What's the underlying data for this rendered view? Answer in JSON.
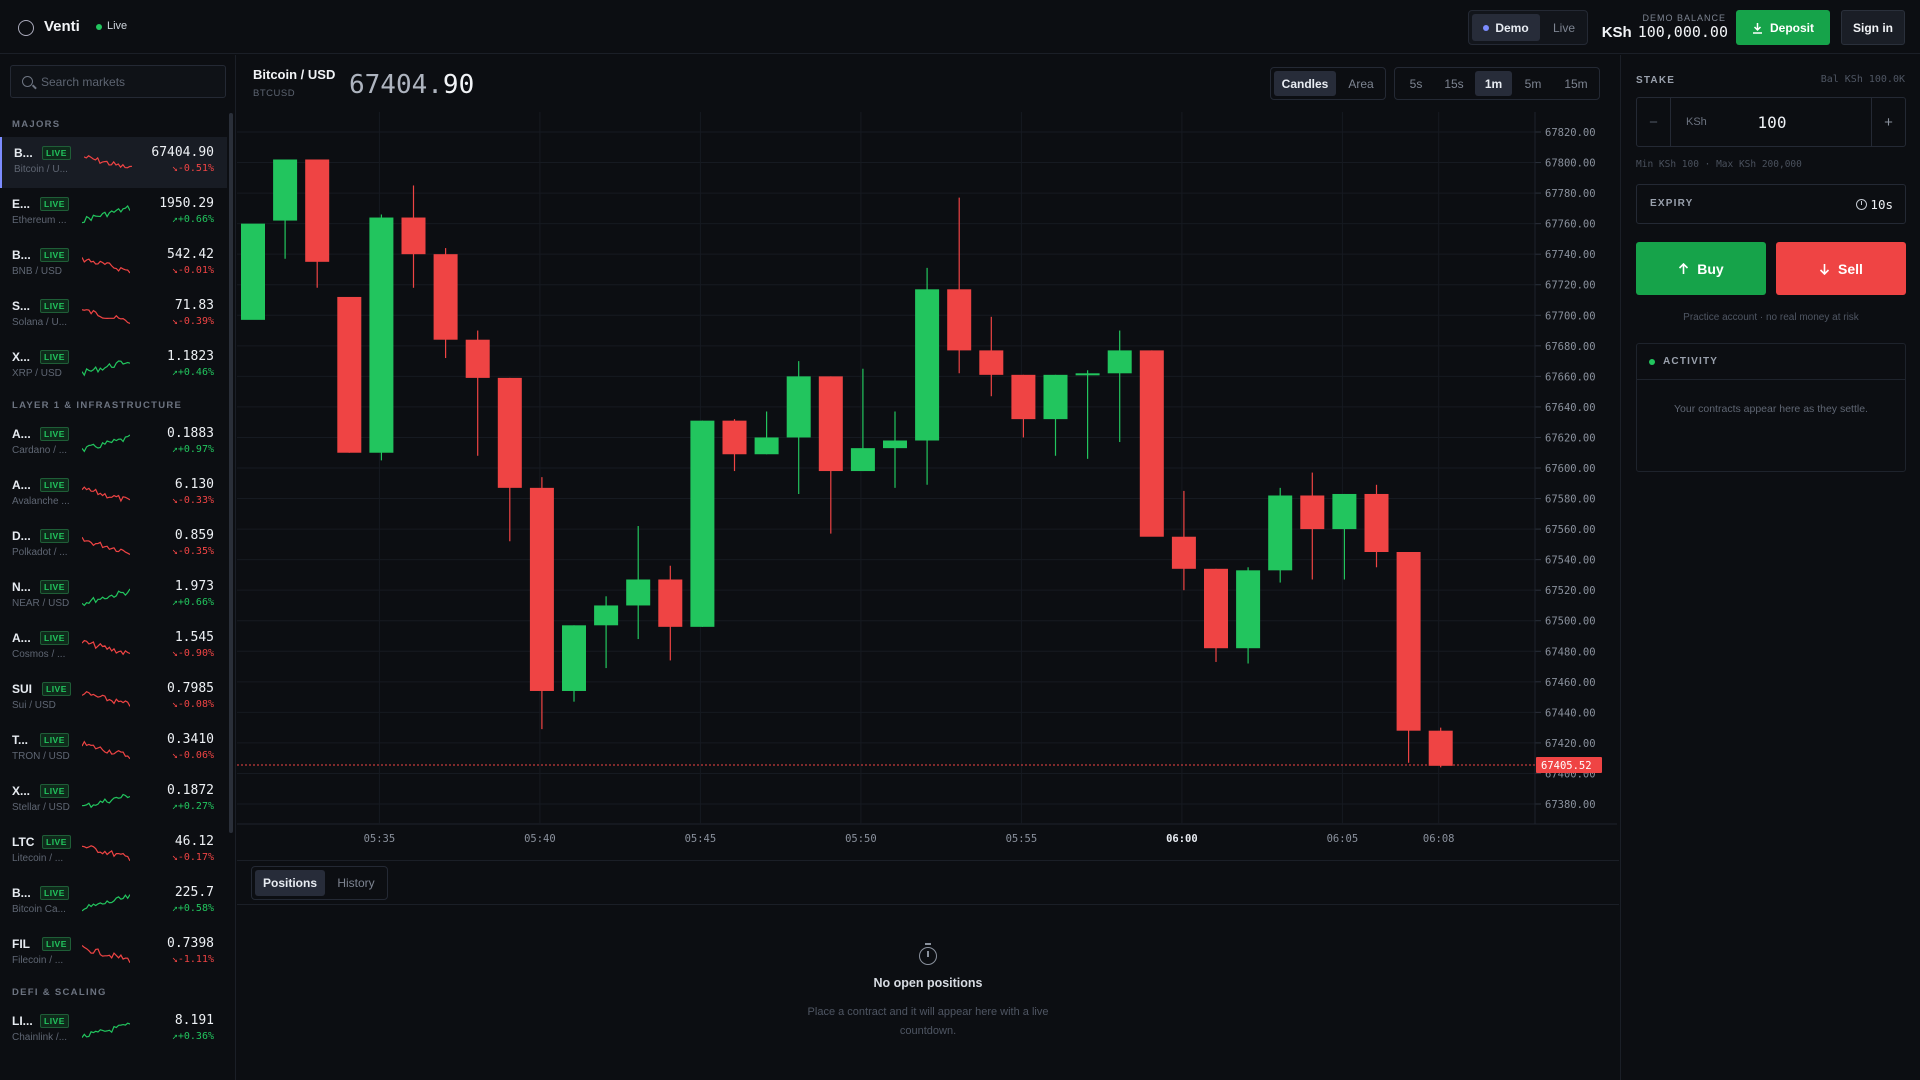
{
  "header": {
    "brand": "Venti",
    "status": "Live",
    "modes": [
      "Demo",
      "Live"
    ],
    "active_mode": "Demo",
    "balance_label": "DEMO BALANCE",
    "balance_currency": "KSh",
    "balance_value": "100,000.00",
    "deposit_label": "Deposit",
    "signin_label": "Sign in"
  },
  "sidebar": {
    "search_placeholder": "Search markets",
    "groups": [
      {
        "title": "MAJORS",
        "items": [
          {
            "sym": "B...",
            "name": "Bitcoin / U...",
            "price": "67404.90",
            "change": "-0.51%",
            "dir": "dn",
            "selected": true
          },
          {
            "sym": "E...",
            "name": "Ethereum ...",
            "price": "1950.29",
            "change": "+0.66%",
            "dir": "up"
          },
          {
            "sym": "B...",
            "name": "BNB / USD",
            "price": "542.42",
            "change": "-0.01%",
            "dir": "dn"
          },
          {
            "sym": "S...",
            "name": "Solana / U...",
            "price": "71.83",
            "change": "-0.39%",
            "dir": "dn"
          },
          {
            "sym": "X...",
            "name": "XRP / USD",
            "price": "1.1823",
            "change": "+0.46%",
            "dir": "up"
          }
        ]
      },
      {
        "title": "LAYER 1 & INFRASTRUCTURE",
        "items": [
          {
            "sym": "A...",
            "name": "Cardano / ...",
            "price": "0.1883",
            "change": "+0.97%",
            "dir": "up"
          },
          {
            "sym": "A...",
            "name": "Avalanche ...",
            "price": "6.130",
            "change": "-0.33%",
            "dir": "dn"
          },
          {
            "sym": "D...",
            "name": "Polkadot / ...",
            "price": "0.859",
            "change": "-0.35%",
            "dir": "dn"
          },
          {
            "sym": "N...",
            "name": "NEAR / USD",
            "price": "1.973",
            "change": "+0.66%",
            "dir": "up"
          },
          {
            "sym": "A...",
            "name": "Cosmos / ...",
            "price": "1.545",
            "change": "-0.90%",
            "dir": "dn"
          },
          {
            "sym": "SUI",
            "name": "Sui / USD",
            "price": "0.7985",
            "change": "-0.08%",
            "dir": "dn"
          },
          {
            "sym": "T...",
            "name": "TRON / USD",
            "price": "0.3410",
            "change": "-0.06%",
            "dir": "dn"
          },
          {
            "sym": "X...",
            "name": "Stellar / USD",
            "price": "0.1872",
            "change": "+0.27%",
            "dir": "up"
          },
          {
            "sym": "LTC",
            "name": "Litecoin / ...",
            "price": "46.12",
            "change": "-0.17%",
            "dir": "dn"
          },
          {
            "sym": "B...",
            "name": "Bitcoin Ca...",
            "price": "225.7",
            "change": "+0.58%",
            "dir": "up"
          },
          {
            "sym": "FIL",
            "name": "Filecoin / ...",
            "price": "0.7398",
            "change": "-1.11%",
            "dir": "dn"
          }
        ]
      },
      {
        "title": "DEFI & SCALING",
        "items": [
          {
            "sym": "LI...",
            "name": "Chainlink /...",
            "price": "8.191",
            "change": "+0.36%",
            "dir": "up"
          }
        ]
      }
    ],
    "badge": "LIVE"
  },
  "chart": {
    "pair": "Bitcoin / USD",
    "code": "BTCUSD",
    "price_dim": "67404.",
    "price_bold": "90",
    "chart_types": [
      "Candles",
      "Area"
    ],
    "active_type": "Candles",
    "timeframes": [
      "5s",
      "15s",
      "1m",
      "5m",
      "15m"
    ],
    "active_timeframe": "1m"
  },
  "chart_data": {
    "type": "candlestick",
    "y_ticks": [
      "67820.00",
      "67800.00",
      "67780.00",
      "67760.00",
      "67740.00",
      "67720.00",
      "67700.00",
      "67680.00",
      "67660.00",
      "67640.00",
      "67620.00",
      "67600.00",
      "67580.00",
      "67560.00",
      "67540.00",
      "67520.00",
      "67500.00",
      "67480.00",
      "67460.00",
      "67440.00",
      "67420.00",
      "67400.00",
      "67380.00"
    ],
    "ylim": [
      67380,
      67820
    ],
    "x_ticks": [
      {
        "label": "05:35",
        "i": 3.5
      },
      {
        "label": "05:40",
        "i": 8.5
      },
      {
        "label": "05:45",
        "i": 13.5
      },
      {
        "label": "05:50",
        "i": 18.5
      },
      {
        "label": "05:55",
        "i": 23.5
      },
      {
        "label": "06:00",
        "i": 28.5,
        "bold": true
      },
      {
        "label": "06:05",
        "i": 33.5
      },
      {
        "label": "06:08",
        "i": 36.5
      }
    ],
    "current_price": "67405.52",
    "current_value": 67405.52,
    "candles": [
      {
        "o": 67697,
        "h": 67697,
        "l": 67697,
        "c": 67760
      },
      {
        "o": 67762,
        "h": 67800,
        "l": 67737,
        "c": 67802
      },
      {
        "o": 67802,
        "h": 67802,
        "l": 67718,
        "c": 67735
      },
      {
        "o": 67712,
        "h": 67712,
        "l": 67610,
        "c": 67610
      },
      {
        "o": 67610,
        "h": 67766,
        "l": 67605,
        "c": 67764
      },
      {
        "o": 67764,
        "h": 67785,
        "l": 67718,
        "c": 67740
      },
      {
        "o": 67740,
        "h": 67744,
        "l": 67672,
        "c": 67684
      },
      {
        "o": 67684,
        "h": 67690,
        "l": 67608,
        "c": 67659
      },
      {
        "o": 67659,
        "h": 67659,
        "l": 67552,
        "c": 67587
      },
      {
        "o": 67587,
        "h": 67594,
        "l": 67429,
        "c": 67454
      },
      {
        "o": 67454,
        "h": 67497,
        "l": 67447,
        "c": 67497
      },
      {
        "o": 67497,
        "h": 67516,
        "l": 67469,
        "c": 67510
      },
      {
        "o": 67510,
        "h": 67562,
        "l": 67488,
        "c": 67527
      },
      {
        "o": 67527,
        "h": 67536,
        "l": 67474,
        "c": 67496
      },
      {
        "o": 67496,
        "h": 67631,
        "l": 67496,
        "c": 67631
      },
      {
        "o": 67631,
        "h": 67632,
        "l": 67598,
        "c": 67609
      },
      {
        "o": 67609,
        "h": 67637,
        "l": 67609,
        "c": 67620
      },
      {
        "o": 67620,
        "h": 67670,
        "l": 67583,
        "c": 67660
      },
      {
        "o": 67660,
        "h": 67660,
        "l": 67557,
        "c": 67598
      },
      {
        "o": 67598,
        "h": 67665,
        "l": 67598,
        "c": 67613
      },
      {
        "o": 67613,
        "h": 67637,
        "l": 67587,
        "c": 67618
      },
      {
        "o": 67618,
        "h": 67731,
        "l": 67589,
        "c": 67717
      },
      {
        "o": 67717,
        "h": 67777,
        "l": 67662,
        "c": 67677
      },
      {
        "o": 67677,
        "h": 67699,
        "l": 67647,
        "c": 67661
      },
      {
        "o": 67661,
        "h": 67661,
        "l": 67620,
        "c": 67632
      },
      {
        "o": 67632,
        "h": 67661,
        "l": 67608,
        "c": 67661
      },
      {
        "o": 67661,
        "h": 67664,
        "l": 67606,
        "c": 67662
      },
      {
        "o": 67662,
        "h": 67690,
        "l": 67617,
        "c": 67677
      },
      {
        "o": 67677,
        "h": 67677,
        "l": 67556,
        "c": 67555
      },
      {
        "o": 67555,
        "h": 67585,
        "l": 67520,
        "c": 67534
      },
      {
        "o": 67534,
        "h": 67534,
        "l": 67473,
        "c": 67482
      },
      {
        "o": 67482,
        "h": 67535,
        "l": 67472,
        "c": 67533
      },
      {
        "o": 67533,
        "h": 67587,
        "l": 67525,
        "c": 67582
      },
      {
        "o": 67582,
        "h": 67597,
        "l": 67527,
        "c": 67560
      },
      {
        "o": 67560,
        "h": 67583,
        "l": 67527,
        "c": 67583
      },
      {
        "o": 67583,
        "h": 67589,
        "l": 67535,
        "c": 67545
      },
      {
        "o": 67545,
        "h": 67545,
        "l": 67407,
        "c": 67428
      },
      {
        "o": 67428,
        "h": 67430,
        "l": 67404,
        "c": 67405
      }
    ],
    "colors": {
      "up": "#22c55e",
      "down": "#ef4444"
    }
  },
  "positions": {
    "tabs": [
      "Positions",
      "History"
    ],
    "active_tab": "Positions",
    "empty_title": "No open positions",
    "empty_desc": "Place a contract and it will appear here with a live countdown."
  },
  "trade": {
    "stake_label": "STAKE",
    "balance_hint": "Bal KSh 100.0K",
    "currency": "KSh",
    "stake_value": "100",
    "limits": "Min KSh 100 · Max KSh 200,000",
    "expiry_label": "EXPIRY",
    "expiry_value": "10s",
    "buy_label": "Buy",
    "sell_label": "Sell",
    "practice_note": "Practice account · no real money at risk",
    "activity_label": "ACTIVITY",
    "activity_empty": "Your contracts appear here as they settle."
  }
}
